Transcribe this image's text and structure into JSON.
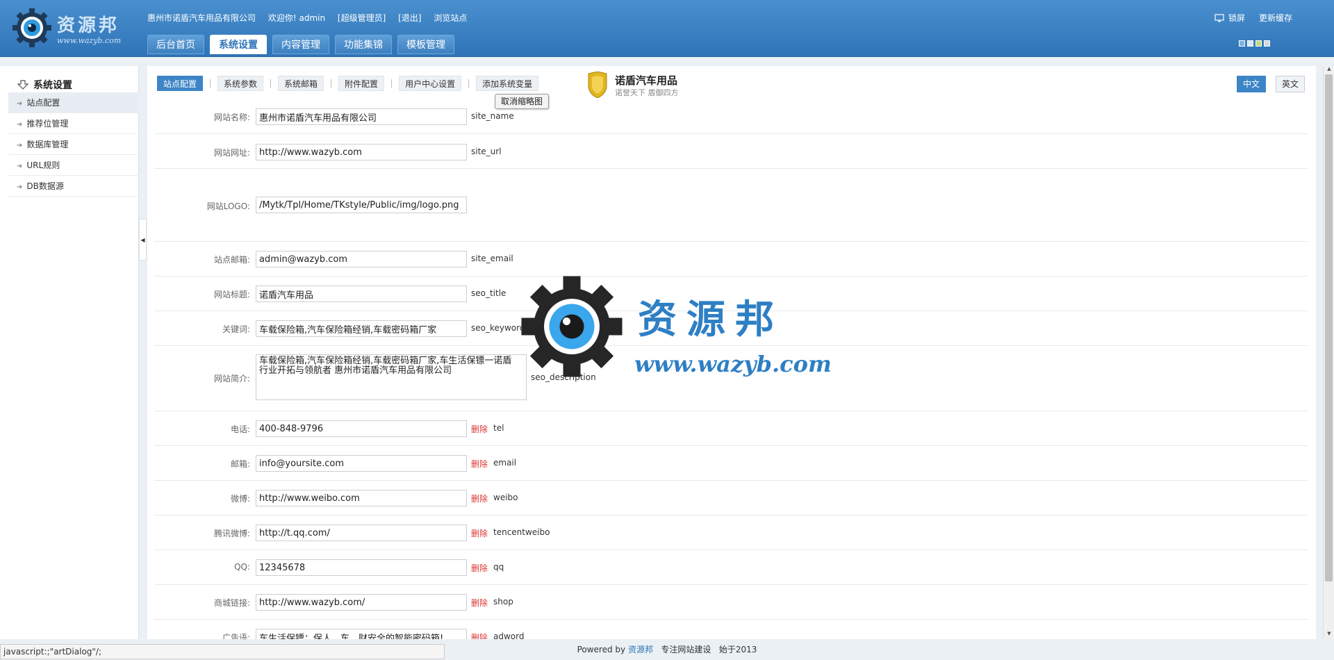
{
  "header": {
    "logo_text": "资源邦",
    "logo_url": "www.wazyb.com",
    "company": "惠州市诺盾汽车用品有限公司",
    "welcome": "欢迎你! admin",
    "role": "[超级管理员]",
    "logout": "[退出]",
    "browse": "浏览站点",
    "lock": "锁屏",
    "update_cache": "更新缓存",
    "tabs": [
      {
        "label": "后台首页"
      },
      {
        "label": "系统设置"
      },
      {
        "label": "内容管理"
      },
      {
        "label": "功能集锦"
      },
      {
        "label": "模板管理"
      }
    ]
  },
  "sidebar": {
    "title": "系统设置",
    "items": [
      {
        "label": "站点配置"
      },
      {
        "label": "推荐位管理"
      },
      {
        "label": "数据库管理"
      },
      {
        "label": "URL规则"
      },
      {
        "label": "DB数据源"
      }
    ]
  },
  "subtabs": [
    {
      "label": "站点配置"
    },
    {
      "label": "系统参数"
    },
    {
      "label": "系统邮箱"
    },
    {
      "label": "附件配置"
    },
    {
      "label": "用户中心设置"
    },
    {
      "label": "添加系统变量"
    }
  ],
  "tooltip": "取消缩略图",
  "brand": {
    "title": "诺盾汽车用品",
    "slogan": "诺誉天下 盾御四方"
  },
  "lang": {
    "zh": "中文",
    "en": "英文"
  },
  "delete_label": "删除",
  "fields": [
    {
      "label": "网站名称:",
      "value": "惠州市诺盾汽车用品有限公司",
      "key": "site_name"
    },
    {
      "label": "网站网址:",
      "value": "http://www.wazyb.com",
      "key": "site_url"
    },
    {
      "label": "网站LOGO:",
      "value": "/Mytk/Tpl/Home/TKstyle/Public/img/logo.png",
      "key": ""
    },
    {
      "label": "站点邮箱:",
      "value": "admin@wazyb.com",
      "key": "site_email"
    },
    {
      "label": "网站标题:",
      "value": "诺盾汽车用品",
      "key": "seo_title"
    },
    {
      "label": "关键词:",
      "value": "车载保险箱,汽车保险箱经销,车载密码箱厂家",
      "key": "seo_keywords"
    },
    {
      "label": "网站简介:",
      "value": "车载保险箱,汽车保险箱经销,车载密码箱厂家,车生活保镖一诺盾 行业开拓与领航者 惠州市诺盾汽车用品有限公司",
      "key": "seo_description"
    },
    {
      "label": "电话:",
      "value": "400-848-9796",
      "key": "tel"
    },
    {
      "label": "邮箱:",
      "value": "info@yoursite.com",
      "key": "email"
    },
    {
      "label": "微博:",
      "value": "http://www.weibo.com",
      "key": "weibo"
    },
    {
      "label": "腾讯微博:",
      "value": "http://t.qq.com/",
      "key": "tencentweibo"
    },
    {
      "label": "QQ:",
      "value": "12345678",
      "key": "qq"
    },
    {
      "label": "商城链接:",
      "value": "http://www.wazyb.com/",
      "key": "shop"
    },
    {
      "label": "广告语:",
      "value": "车生活保镖：保人、车、财安全的智能密码箱!",
      "key": "adword"
    }
  ],
  "footer": {
    "powered": "Powered by",
    "link": "资源邦",
    "slogan": "专注网站建设",
    "since": "始于2013"
  },
  "statusbar": "javascript:;\"artDialog\"/;",
  "watermark": {
    "title": "资源邦",
    "url": "www.wazyb.com"
  },
  "colors": {
    "header": "#3a82c4",
    "accent": "#3d85c6",
    "delete": "#dd3333"
  }
}
